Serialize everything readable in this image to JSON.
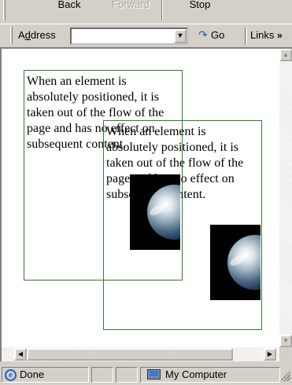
{
  "toolbar": {
    "back_label": "Back",
    "forward_label": "Forward",
    "stop_label": "Stop"
  },
  "address_bar": {
    "label_accel": "d",
    "label_rest": "dress",
    "label_first": "A",
    "url_value": "",
    "go_label": "Go",
    "links_label": "Links",
    "links_chevron": "»"
  },
  "page": {
    "box1_text": "When an element is absolutely positioned, it is taken out of the flow of the page and has no effect on subsequent content.",
    "box2_text": "When an element is absolutely positioned, it is taken out of the flow of the page and has no effect on subsequent content."
  },
  "status_bar": {
    "status_text": "Done",
    "zone_text": "My Computer"
  },
  "colors": {
    "chrome": "#d4d0c8",
    "box_border": "#2e7d2e",
    "page_background": "#ffffff"
  },
  "icons": {
    "address_dropdown": "chevron-down-icon",
    "go": "go-arrow-icon",
    "status_page": "ie-page-icon",
    "zone": "my-computer-icon"
  }
}
